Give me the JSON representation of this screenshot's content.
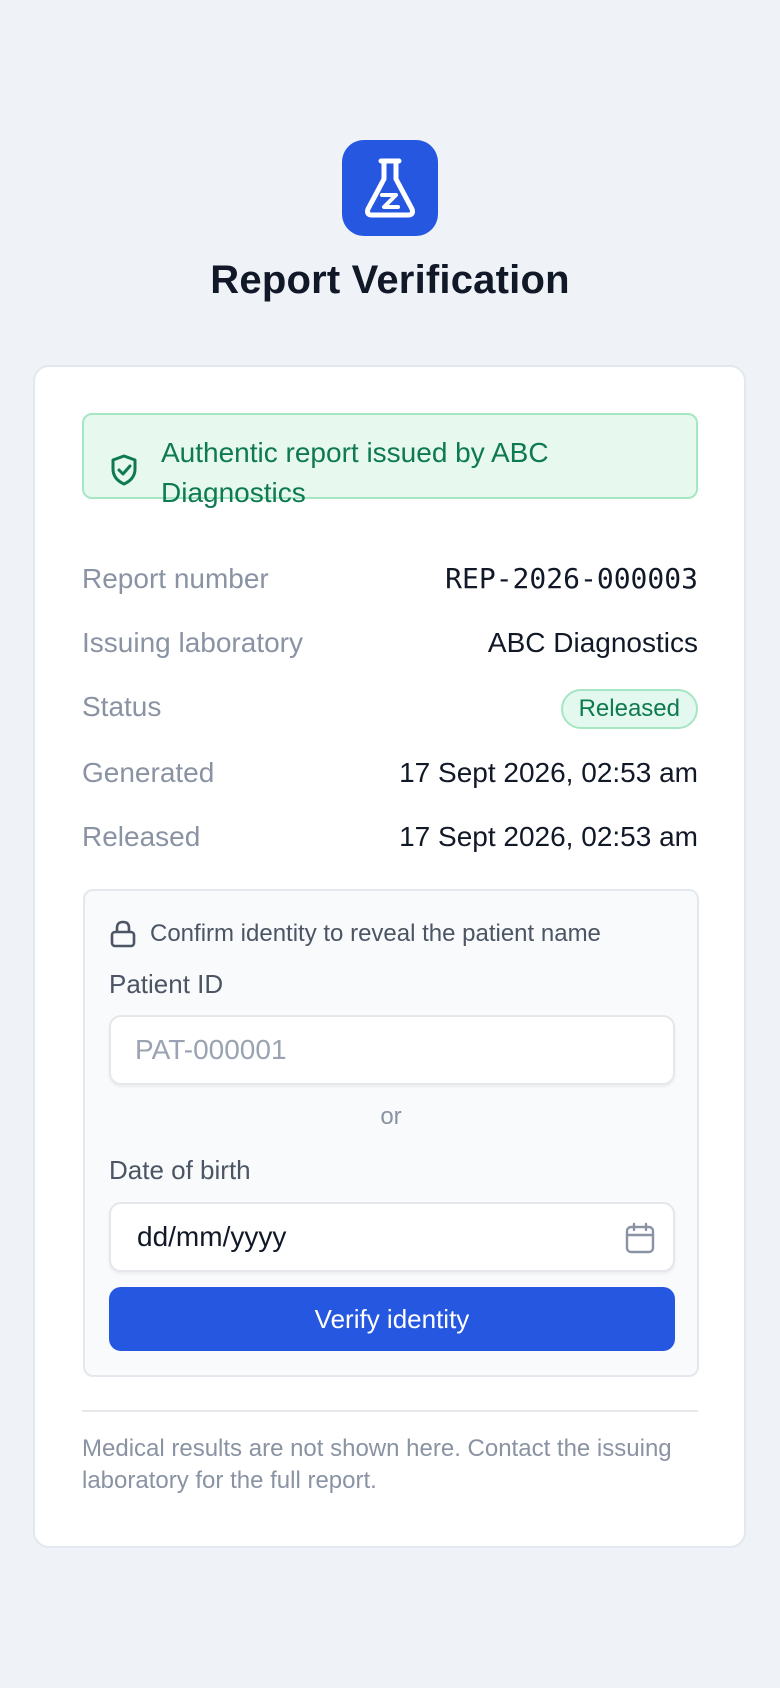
{
  "header": {
    "logo_icon": "flask-icon",
    "title": "Report Verification"
  },
  "banner": {
    "icon": "shield-check-icon",
    "text": "Authentic report issued by ABC Diagnostics"
  },
  "details": [
    {
      "label": "Report number",
      "value": "REP-2026-000003"
    },
    {
      "label": "Issuing laboratory",
      "value": "ABC Diagnostics"
    },
    {
      "label": "Status",
      "value": "Released"
    },
    {
      "label": "Generated",
      "value": "17 Sept 2026, 02:53 am"
    },
    {
      "label": "Released",
      "value": "17 Sept 2026, 02:53 am"
    }
  ],
  "identity": {
    "icon": "lock-icon",
    "note": "Confirm identity to reveal the patient name",
    "patient_id_label": "Patient ID",
    "patient_id_placeholder": "PAT-000001",
    "or_text": "or",
    "dob_label": "Date of birth",
    "dob_placeholder": "dd/mm/yyyy",
    "dob_icon": "calendar-icon",
    "button_label": "Verify identity"
  },
  "footer": {
    "text": "Medical results are not shown here. Contact the issuing laboratory for the full report."
  },
  "colors": {
    "accent": "#2557e0",
    "success_text": "#0e7a4f",
    "success_bg": "#e7f8ef",
    "page_bg": "#eff2f7"
  }
}
